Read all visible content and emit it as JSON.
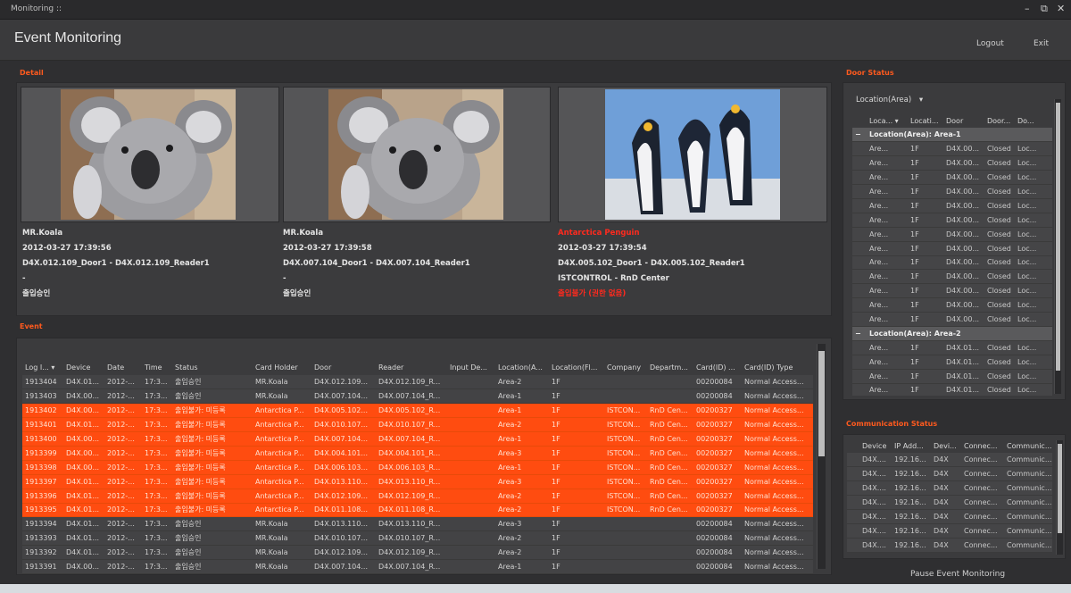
{
  "window": {
    "title": "Monitoring ::",
    "controls": [
      "–",
      "⧉",
      "✕"
    ]
  },
  "header": {
    "title": "Event Monitoring",
    "logout_label": "Logout",
    "exit_label": "Exit"
  },
  "detail": {
    "label": "Detail",
    "cards": [
      {
        "name": "MR.Koala",
        "time": "2012-03-27  17:39:56",
        "door": "D4X.012.109_Door1 - D4X.012.109_Reader1",
        "extra": "-",
        "status": "출입승인",
        "alarm": false
      },
      {
        "name": "MR.Koala",
        "time": "2012-03-27  17:39:58",
        "door": "D4X.007.104_Door1 - D4X.007.104_Reader1",
        "extra": "-",
        "status": "출입승인",
        "alarm": false
      },
      {
        "name": "Antarctica Penguin",
        "time": "2012-03-27  17:39:54",
        "door": "D4X.005.102_Door1 - D4X.005.102_Reader1",
        "extra": "ISTCONTROL - RnD Center",
        "status": "출입불가 (권한 없음)",
        "alarm": true
      }
    ]
  },
  "event": {
    "label": "Event",
    "columns": [
      "Log I... ▾",
      "Device",
      "Date",
      "Time",
      "Status",
      "Card Holder",
      "Door",
      "Reader",
      "Input De...",
      "Location(A...",
      "Location(Fl...",
      "Company",
      "Departm...",
      "Card(ID) ...",
      "Card(ID) Type"
    ],
    "rows": [
      {
        "cells": [
          "1913404",
          "D4X.01...",
          "2012-...",
          "17:3...",
          "출입승인",
          "MR.Koala",
          "D4X.012.109...",
          "D4X.012.109_R...",
          "",
          "Area-2",
          "1F",
          "",
          "",
          "00200084",
          "Normal Access..."
        ],
        "alarm": false,
        "selected": true
      },
      {
        "cells": [
          "1913403",
          "D4X.00...",
          "2012-...",
          "17:3...",
          "출입승인",
          "MR.Koala",
          "D4X.007.104...",
          "D4X.007.104_R...",
          "",
          "Area-1",
          "1F",
          "",
          "",
          "00200084",
          "Normal Access..."
        ],
        "alarm": false
      },
      {
        "cells": [
          "1913402",
          "D4X.00...",
          "2012-...",
          "17:3...",
          "출입불가: 미등록",
          "Antarctica P...",
          "D4X.005.102...",
          "D4X.005.102_R...",
          "",
          "Area-1",
          "1F",
          "ISTCON...",
          "RnD Cen...",
          "00200327",
          "Normal Access..."
        ],
        "alarm": true
      },
      {
        "cells": [
          "1913401",
          "D4X.01...",
          "2012-...",
          "17:3...",
          "출입불가: 미등록",
          "Antarctica P...",
          "D4X.010.107...",
          "D4X.010.107_R...",
          "",
          "Area-2",
          "1F",
          "ISTCON...",
          "RnD Cen...",
          "00200327",
          "Normal Access..."
        ],
        "alarm": true
      },
      {
        "cells": [
          "1913400",
          "D4X.00...",
          "2012-...",
          "17:3...",
          "출입불가: 미등록",
          "Antarctica P...",
          "D4X.007.104...",
          "D4X.007.104_R...",
          "",
          "Area-1",
          "1F",
          "ISTCON...",
          "RnD Cen...",
          "00200327",
          "Normal Access..."
        ],
        "alarm": true
      },
      {
        "cells": [
          "1913399",
          "D4X.00...",
          "2012-...",
          "17:3...",
          "출입불가: 미등록",
          "Antarctica P...",
          "D4X.004.101...",
          "D4X.004.101_R...",
          "",
          "Area-3",
          "1F",
          "ISTCON...",
          "RnD Cen...",
          "00200327",
          "Normal Access..."
        ],
        "alarm": true
      },
      {
        "cells": [
          "1913398",
          "D4X.00...",
          "2012-...",
          "17:3...",
          "출입불가: 미등록",
          "Antarctica P...",
          "D4X.006.103...",
          "D4X.006.103_R...",
          "",
          "Area-1",
          "1F",
          "ISTCON...",
          "RnD Cen...",
          "00200327",
          "Normal Access..."
        ],
        "alarm": true
      },
      {
        "cells": [
          "1913397",
          "D4X.01...",
          "2012-...",
          "17:3...",
          "출입불가: 미등록",
          "Antarctica P...",
          "D4X.013.110...",
          "D4X.013.110_R...",
          "",
          "Area-3",
          "1F",
          "ISTCON...",
          "RnD Cen...",
          "00200327",
          "Normal Access..."
        ],
        "alarm": true
      },
      {
        "cells": [
          "1913396",
          "D4X.01...",
          "2012-...",
          "17:3...",
          "출입불가: 미등록",
          "Antarctica P...",
          "D4X.012.109...",
          "D4X.012.109_R...",
          "",
          "Area-2",
          "1F",
          "ISTCON...",
          "RnD Cen...",
          "00200327",
          "Normal Access..."
        ],
        "alarm": true
      },
      {
        "cells": [
          "1913395",
          "D4X.01...",
          "2012-...",
          "17:3...",
          "출입불가: 미등록",
          "Antarctica P...",
          "D4X.011.108...",
          "D4X.011.108_R...",
          "",
          "Area-2",
          "1F",
          "ISTCON...",
          "RnD Cen...",
          "00200327",
          "Normal Access..."
        ],
        "alarm": true
      },
      {
        "cells": [
          "1913394",
          "D4X.01...",
          "2012-...",
          "17:3...",
          "출입승인",
          "MR.Koala",
          "D4X.013.110...",
          "D4X.013.110_R...",
          "",
          "Area-3",
          "1F",
          "",
          "",
          "00200084",
          "Normal Access..."
        ],
        "alarm": false
      },
      {
        "cells": [
          "1913393",
          "D4X.01...",
          "2012-...",
          "17:3...",
          "출입승인",
          "MR.Koala",
          "D4X.010.107...",
          "D4X.010.107_R...",
          "",
          "Area-2",
          "1F",
          "",
          "",
          "00200084",
          "Normal Access..."
        ],
        "alarm": false
      },
      {
        "cells": [
          "1913392",
          "D4X.01...",
          "2012-...",
          "17:3...",
          "출입승인",
          "MR.Koala",
          "D4X.012.109...",
          "D4X.012.109_R...",
          "",
          "Area-2",
          "1F",
          "",
          "",
          "00200084",
          "Normal Access..."
        ],
        "alarm": false
      },
      {
        "cells": [
          "1913391",
          "D4X.00...",
          "2012-...",
          "17:3...",
          "출입승인",
          "MR.Koala",
          "D4X.007.104...",
          "D4X.007.104_R...",
          "",
          "Area-1",
          "1F",
          "",
          "",
          "00200084",
          "Normal Access..."
        ],
        "alarm": false
      }
    ]
  },
  "door_status": {
    "label": "Door Status",
    "group_by": "Location(Area)",
    "columns": [
      "Loca... ▾",
      "Locati...",
      "Door",
      "Door...",
      "Do..."
    ],
    "groups": [
      {
        "title": "Location(Area): Area-1",
        "rows": [
          [
            "Are...",
            "1F",
            "D4X.00...",
            "Closed",
            "Loc..."
          ],
          [
            "Are...",
            "1F",
            "D4X.00...",
            "Closed",
            "Loc..."
          ],
          [
            "Are...",
            "1F",
            "D4X.00...",
            "Closed",
            "Loc..."
          ],
          [
            "Are...",
            "1F",
            "D4X.00...",
            "Closed",
            "Loc..."
          ],
          [
            "Are...",
            "1F",
            "D4X.00...",
            "Closed",
            "Loc..."
          ],
          [
            "Are...",
            "1F",
            "D4X.00...",
            "Closed",
            "Loc..."
          ],
          [
            "Are...",
            "1F",
            "D4X.00...",
            "Closed",
            "Loc..."
          ],
          [
            "Are...",
            "1F",
            "D4X.00...",
            "Closed",
            "Loc..."
          ],
          [
            "Are...",
            "1F",
            "D4X.00...",
            "Closed",
            "Loc..."
          ],
          [
            "Are...",
            "1F",
            "D4X.00...",
            "Closed",
            "Loc..."
          ],
          [
            "Are...",
            "1F",
            "D4X.00...",
            "Closed",
            "Loc..."
          ],
          [
            "Are...",
            "1F",
            "D4X.00...",
            "Closed",
            "Loc..."
          ],
          [
            "Are...",
            "1F",
            "D4X.00...",
            "Closed",
            "Loc..."
          ]
        ]
      },
      {
        "title": "Location(Area): Area-2",
        "rows": [
          [
            "Are...",
            "1F",
            "D4X.01...",
            "Closed",
            "Loc..."
          ],
          [
            "Are...",
            "1F",
            "D4X.01...",
            "Closed",
            "Loc..."
          ],
          [
            "Are...",
            "1F",
            "D4X.01...",
            "Closed",
            "Loc..."
          ],
          [
            "Are...",
            "1F",
            "D4X.01...",
            "Closed",
            "Loc..."
          ],
          [
            "Are...",
            "1F",
            "D4X.01...",
            "Closed",
            "Loc..."
          ]
        ]
      }
    ]
  },
  "comm_status": {
    "label": "Communication Status",
    "columns": [
      "Device",
      "IP Add...",
      "Devi...",
      "Connec...",
      "Communic..."
    ],
    "rows": [
      [
        "D4X....",
        "192.16...",
        "D4X",
        "Connec...",
        "Communic..."
      ],
      [
        "D4X....",
        "192.16...",
        "D4X",
        "Connec...",
        "Communic..."
      ],
      [
        "D4X....",
        "192.16...",
        "D4X",
        "Connec...",
        "Communic..."
      ],
      [
        "D4X....",
        "192.16...",
        "D4X",
        "Connec...",
        "Communic..."
      ],
      [
        "D4X....",
        "192.16...",
        "D4X",
        "Connec...",
        "Communic..."
      ],
      [
        "D4X....",
        "192.16...",
        "D4X",
        "Connec...",
        "Communic..."
      ],
      [
        "D4X....",
        "192.16...",
        "D4X",
        "Connec...",
        "Communic..."
      ]
    ],
    "pause_label": "Pause Event Monitoring"
  },
  "colors": {
    "alarm_row": "#ff4c10",
    "alarm_text": "#ff2a1e",
    "section_label": "#ff5a1e"
  }
}
